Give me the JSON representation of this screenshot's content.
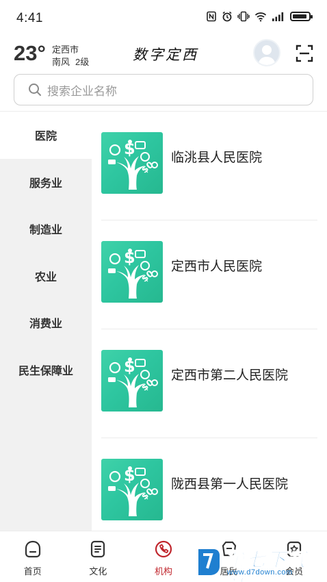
{
  "status_bar": {
    "time": "4:41"
  },
  "header": {
    "temperature": "23°",
    "city": "定西市",
    "wind_direction": "南风",
    "wind_level": "2级",
    "app_title": "数字定西"
  },
  "search": {
    "placeholder": "搜索企业名称"
  },
  "categories": [
    {
      "label": "医院",
      "active": true
    },
    {
      "label": "服务业",
      "active": false
    },
    {
      "label": "制造业",
      "active": false
    },
    {
      "label": "农业",
      "active": false
    },
    {
      "label": "消费业",
      "active": false
    },
    {
      "label": "民生保障业",
      "active": false
    }
  ],
  "institutions": [
    {
      "name": "临洮县人民医院"
    },
    {
      "name": "定西市人民医院"
    },
    {
      "name": "定西市第二人民医院"
    },
    {
      "name": "陇西县第一人民医院"
    }
  ],
  "bottom_nav": [
    {
      "label": "首页",
      "icon": "home-icon",
      "active": false
    },
    {
      "label": "文化",
      "icon": "culture-icon",
      "active": false
    },
    {
      "label": "机构",
      "icon": "institution-icon",
      "active": true
    },
    {
      "label": "居民",
      "icon": "resident-icon",
      "active": false
    },
    {
      "label": "会员",
      "icon": "member-icon",
      "active": false
    }
  ],
  "watermark": {
    "title": "第七下载站",
    "url": "www.d7down.com"
  },
  "colors": {
    "accent": "#c0262d",
    "thumb": "#2ec6a0",
    "sidebar_bg": "#f1f1f1"
  }
}
